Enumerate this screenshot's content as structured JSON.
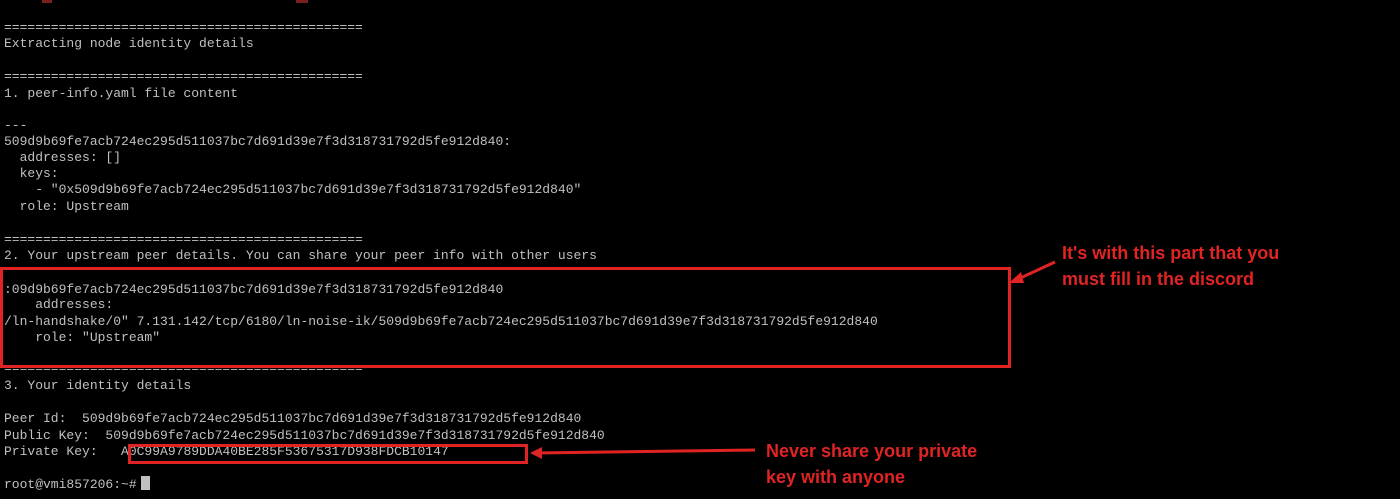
{
  "terminal": {
    "lines": {
      "sep1": "==============================================",
      "extracting": "Extracting node identity details",
      "sep2": "==============================================",
      "section1": "1. peer-info.yaml file content",
      "yaml_start": "---",
      "peer_key": "509d9b69fe7acb724ec295d511037bc7d691d39e7f3d318731792d5fe912d840:",
      "addresses": "  addresses: []",
      "keys": "  keys:",
      "key_item": "    - \"0x509d9b69fe7acb724ec295d511037bc7d691d39e7f3d318731792d5fe912d840\"",
      "role": "  role: Upstream",
      "sep3": "==============================================",
      "section2": "2. Your upstream peer details. You can share your peer info with other users",
      "peer_line": ":09d9b69fe7acb724ec295d511037bc7d691d39e7f3d318731792d5fe912d840",
      "peer_addresses": "    addresses:",
      "peer_handshake": "/ln-handshake/0\" 7.131.142/tcp/6180/ln-noise-ik/509d9b69fe7acb724ec295d511037bc7d691d39e7f3d318731792d5fe912d840",
      "peer_role": "    role: \"Upstream\"",
      "sep4": "==============================================",
      "section3": "3. Your identity details",
      "peer_id": "Peer Id:  509d9b69fe7acb724ec295d511037bc7d691d39e7f3d318731792d5fe912d840",
      "public_key": "Public Key:  509d9b69fe7acb724ec295d511037bc7d691d39e7f3d318731792d5fe912d840",
      "private_key_label": "Private Key:  ",
      "private_key_value": "A0C99A9789DDA40BE285F53675317D938FDCB10147",
      "prompt": "root@vmi857206:~#"
    }
  },
  "annotations": {
    "discord_note": "It's with this part that you\nmust fill in the discord",
    "private_note": "Never share your private\nkey with anyone"
  },
  "colors": {
    "background": "#000000",
    "text": "#c0c0c0",
    "annotation": "#e02424"
  }
}
